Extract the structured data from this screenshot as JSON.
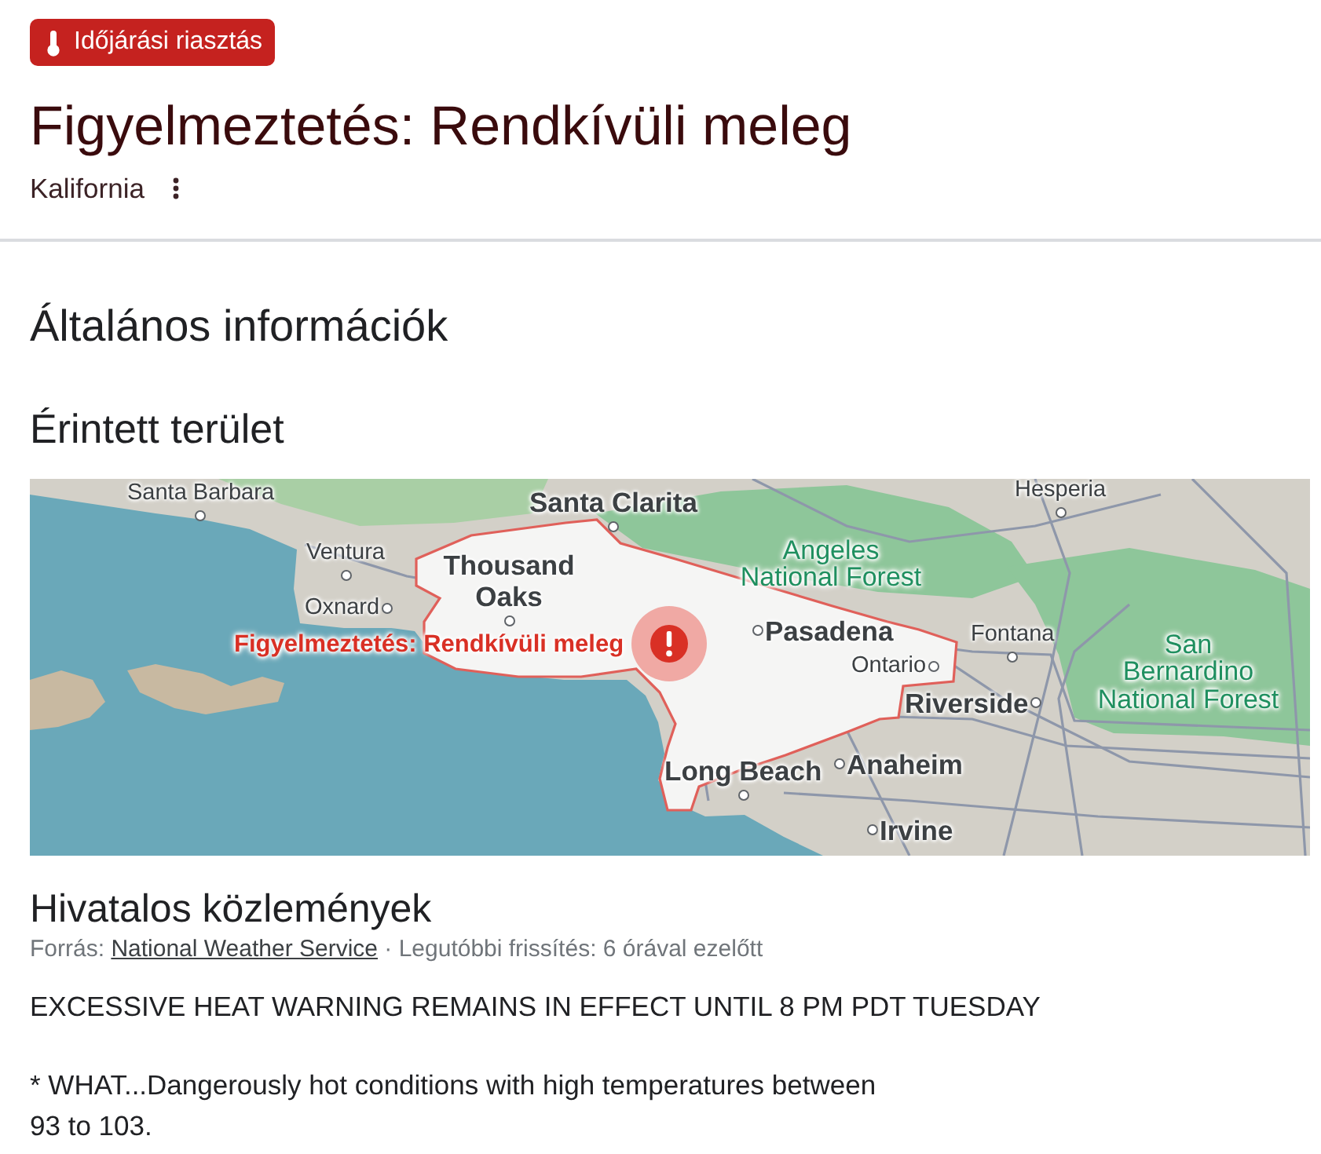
{
  "alert_badge": {
    "label": "Időjárási riasztás"
  },
  "title": "Figyelmeztetés: Rendkívüli meleg",
  "region": "Kalifornia",
  "general_heading": "Általános információk",
  "affected_area": {
    "heading": "Érintett terület",
    "map": {
      "labels": [
        {
          "text": "Santa Barbara",
          "kind": "city"
        },
        {
          "text": "Santa Clarita",
          "kind": "major"
        },
        {
          "text": "Hesperia",
          "kind": "city"
        },
        {
          "text": "Ventura",
          "kind": "city"
        },
        {
          "text": "Thousand Oaks",
          "kind": "major"
        },
        {
          "text": "Angeles National Forest",
          "kind": "forest"
        },
        {
          "text": "Oxnard",
          "kind": "city"
        },
        {
          "text": "Figyelmeztetés: Rendkívüli meleg",
          "kind": "alert"
        },
        {
          "text": "Pasadena",
          "kind": "major"
        },
        {
          "text": "Fontana",
          "kind": "city"
        },
        {
          "text": "Ontario",
          "kind": "city"
        },
        {
          "text": "Riverside",
          "kind": "major"
        },
        {
          "text": "San Bernardino National Forest",
          "kind": "forest"
        },
        {
          "text": "Long Beach",
          "kind": "major"
        },
        {
          "text": "Anaheim",
          "kind": "major"
        },
        {
          "text": "Irvine",
          "kind": "major"
        }
      ]
    }
  },
  "official_statements": {
    "heading": "Hivatalos közlemények",
    "source": {
      "prefix": "Forrás:",
      "link": "National Weather Service",
      "separator": "·",
      "updated": "Legutóbbi frissítés: 6 órával ezelőtt"
    },
    "paragraphs": [
      "EXCESSIVE HEAT WARNING REMAINS IN EFFECT UNTIL 8 PM PDT TUESDAY",
      "* WHAT...Dangerously hot conditions with high temperatures between\n93 to 103."
    ]
  }
}
